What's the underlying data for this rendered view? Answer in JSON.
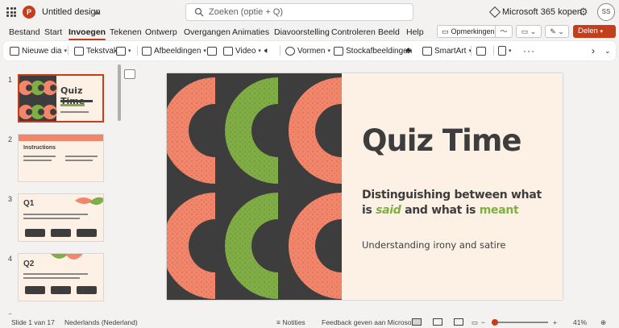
{
  "titlebar": {
    "app_initial": "P",
    "doc_title": "Untitled design",
    "search_placeholder": "Zoeken (optie + Q)",
    "premium_label": "Microsoft 365 kopen",
    "avatar_initials": "SS"
  },
  "tabs": [
    "Bestand",
    "Start",
    "Invoegen",
    "Tekenen",
    "Ontwerp",
    "Overgangen",
    "Animaties",
    "Diavoorstelling",
    "Controleren",
    "Beeld",
    "Help"
  ],
  "active_tab": "Invoegen",
  "actions": {
    "comments_label": "Opmerkingen",
    "share_label": "Delen"
  },
  "ribbon": {
    "new_slide": "Nieuwe dia",
    "textbox": "Tekstvak",
    "images": "Afbeeldingen",
    "video": "Video",
    "shapes": "Vormen",
    "stock_images": "Stockafbeeldingen",
    "smartart": "SmartArt"
  },
  "thumbnails": [
    {
      "number": "1",
      "title": "Quiz Time",
      "selected": true
    },
    {
      "number": "2",
      "title": "Instructions",
      "selected": false
    },
    {
      "number": "3",
      "title": "Q1",
      "selected": false
    },
    {
      "number": "4",
      "title": "Q2",
      "selected": false
    },
    {
      "number": "5",
      "title": "",
      "selected": false
    }
  ],
  "slide": {
    "title": "Quiz Time",
    "subtitle_line1": "Distinguishing between what",
    "subtitle_is": "is",
    "subtitle_said": "said",
    "subtitle_mid": "and what is",
    "subtitle_meant": "meant",
    "body": "Understanding irony and satire"
  },
  "status": {
    "slide_counter": "Slide 1 van 17",
    "language": "Nederlands (Nederland)",
    "notes": "Notities",
    "feedback": "Feedback geven aan Microsoft",
    "zoom": "41%"
  },
  "colors": {
    "accent": "#c43e1c",
    "salmon": "#f3866a",
    "green": "#7fae45",
    "dark": "#3d3d3d",
    "cream": "#fdf1e6"
  }
}
